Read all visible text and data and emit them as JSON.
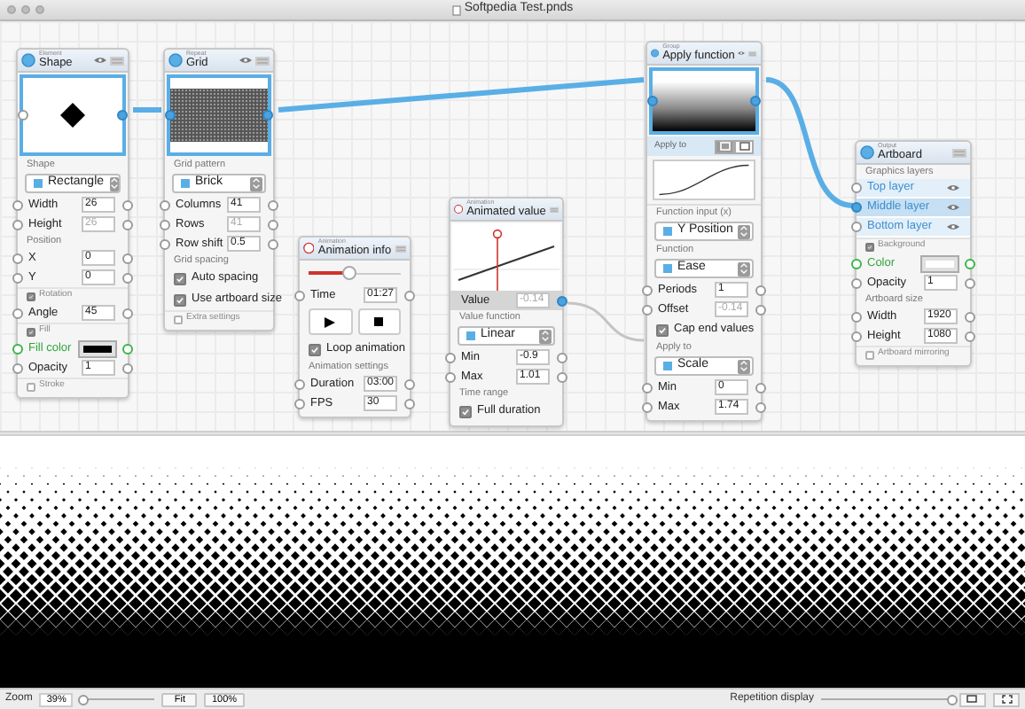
{
  "window": {
    "title": "Softpedia Test.pnds"
  },
  "nodes": [
    {
      "category": "Element",
      "title": "Shape",
      "eye": true,
      "rows": [
        {
          "kind": "diamond"
        },
        {
          "kind": "caption",
          "text": "Shape"
        },
        {
          "kind": "select",
          "value": "Rectangle"
        },
        {
          "kind": "number",
          "label": "Width",
          "value": "26",
          "disabled": false
        },
        {
          "kind": "number",
          "label": "Height",
          "value": "26",
          "disabled": true
        },
        {
          "kind": "caption",
          "text": "Position"
        },
        {
          "kind": "number",
          "label": "X",
          "value": "0",
          "disabled": false
        },
        {
          "kind": "number",
          "label": "Y",
          "value": "0",
          "disabled": false
        },
        {
          "kind": "option",
          "label": "Rotation",
          "checked": true
        },
        {
          "kind": "number",
          "label": "Angle",
          "value": "45",
          "disabled": false
        },
        {
          "kind": "option",
          "label": "Fill",
          "checked": true
        },
        {
          "kind": "color",
          "label": "Fill color",
          "color": "#000000"
        },
        {
          "kind": "number",
          "label": "Opacity",
          "value": "1",
          "disabled": false
        },
        {
          "kind": "option",
          "label": "Stroke",
          "checked": false
        }
      ]
    },
    {
      "category": "Repeat",
      "title": "Grid",
      "eye": true,
      "rows": [
        {
          "kind": "pattern"
        },
        {
          "kind": "caption",
          "text": "Grid pattern"
        },
        {
          "kind": "select",
          "value": "Brick"
        },
        {
          "kind": "number",
          "label": "Columns",
          "value": "41",
          "disabled": false
        },
        {
          "kind": "number",
          "label": "Rows",
          "value": "41",
          "disabled": true
        },
        {
          "kind": "number",
          "label": "Row shift",
          "value": "0.5",
          "disabled": false
        },
        {
          "kind": "caption",
          "text": "Grid spacing"
        },
        {
          "kind": "checkbox",
          "label": "Auto spacing",
          "checked": true
        },
        {
          "kind": "checkbox",
          "label": "Use artboard size",
          "checked": true
        },
        {
          "kind": "option",
          "label": "Extra settings",
          "checked": false
        }
      ]
    },
    {
      "category": "Animation",
      "title": "Animation info",
      "eye": false,
      "rows": [
        {
          "kind": "slider",
          "level": 0.45
        },
        {
          "kind": "number",
          "label": "Time",
          "value": "01:27",
          "disabled": false
        },
        {
          "kind": "transport"
        },
        {
          "kind": "checkbox",
          "label": "Loop animation",
          "checked": true
        },
        {
          "kind": "caption",
          "text": "Animation settings"
        },
        {
          "kind": "number",
          "label": "Duration",
          "value": "03:00",
          "disabled": false
        },
        {
          "kind": "number",
          "label": "FPS",
          "value": "30",
          "disabled": false
        }
      ]
    },
    {
      "category": "Animation",
      "title": "Animated value",
      "eye": false,
      "rows": [
        {
          "kind": "graph"
        },
        {
          "kind": "output",
          "label": "Value",
          "value": "-0.14"
        },
        {
          "kind": "caption",
          "text": "Value function"
        },
        {
          "kind": "select",
          "value": "Linear"
        },
        {
          "kind": "number",
          "label": "Min",
          "value": "-0.9",
          "disabled": false
        },
        {
          "kind": "number",
          "label": "Max",
          "value": "1.01",
          "disabled": false
        },
        {
          "kind": "caption",
          "text": "Time range"
        },
        {
          "kind": "checkbox",
          "label": "Full duration",
          "checked": true
        }
      ]
    },
    {
      "category": "Group",
      "title": "Apply function",
      "eye": true,
      "rows": [
        {
          "kind": "gradient"
        },
        {
          "kind": "applyto",
          "text": "Apply to",
          "options": [
            {
              "selected": true
            },
            {
              "selected": false
            }
          ]
        },
        {
          "kind": "curve"
        },
        {
          "kind": "caption",
          "text": "Function input (x)"
        },
        {
          "kind": "select",
          "value": "Y Position"
        },
        {
          "kind": "caption",
          "text": "Function"
        },
        {
          "kind": "select",
          "value": "Ease"
        },
        {
          "kind": "number",
          "label": "Periods",
          "value": "1",
          "disabled": false
        },
        {
          "kind": "number",
          "label": "Offset",
          "value": "-0.14",
          "disabled": true
        },
        {
          "kind": "checkbox",
          "label": "Cap end values",
          "checked": true
        },
        {
          "kind": "caption",
          "text": "Apply to"
        },
        {
          "kind": "select",
          "value": "Scale"
        },
        {
          "kind": "number",
          "label": "Min",
          "value": "0",
          "disabled": false
        },
        {
          "kind": "number",
          "label": "Max",
          "value": "1.74",
          "disabled": false
        }
      ]
    },
    {
      "category": "Output",
      "title": "Artboard",
      "eye": false,
      "rows": [
        {
          "kind": "caption",
          "text": "Graphics layers"
        },
        {
          "kind": "layer",
          "label": "Top layer",
          "selected": false
        },
        {
          "kind": "layer",
          "label": "Middle layer",
          "selected": true
        },
        {
          "kind": "layer",
          "label": "Bottom layer",
          "selected": false
        },
        {
          "kind": "option",
          "label": "Background",
          "checked": true
        },
        {
          "kind": "color",
          "label": "Color",
          "color": "#ffffff"
        },
        {
          "kind": "number",
          "label": "Opacity",
          "value": "1",
          "disabled": false
        },
        {
          "kind": "caption",
          "text": "Artboard size"
        },
        {
          "kind": "number",
          "label": "Width",
          "value": "1920",
          "disabled": false
        },
        {
          "kind": "number",
          "label": "Height",
          "value": "1080",
          "disabled": false
        },
        {
          "kind": "option",
          "label": "Artboard mirroring",
          "checked": false
        }
      ]
    }
  ],
  "status_bar": {
    "zoom_label": "Zoom",
    "zoom_value": "39%",
    "zoom_slider": {
      "level": 0.05
    },
    "fit_button": "Fit",
    "actual_button": "100%",
    "repetition_label": "Repetition display",
    "repetition_slider": {
      "level": 1
    }
  }
}
